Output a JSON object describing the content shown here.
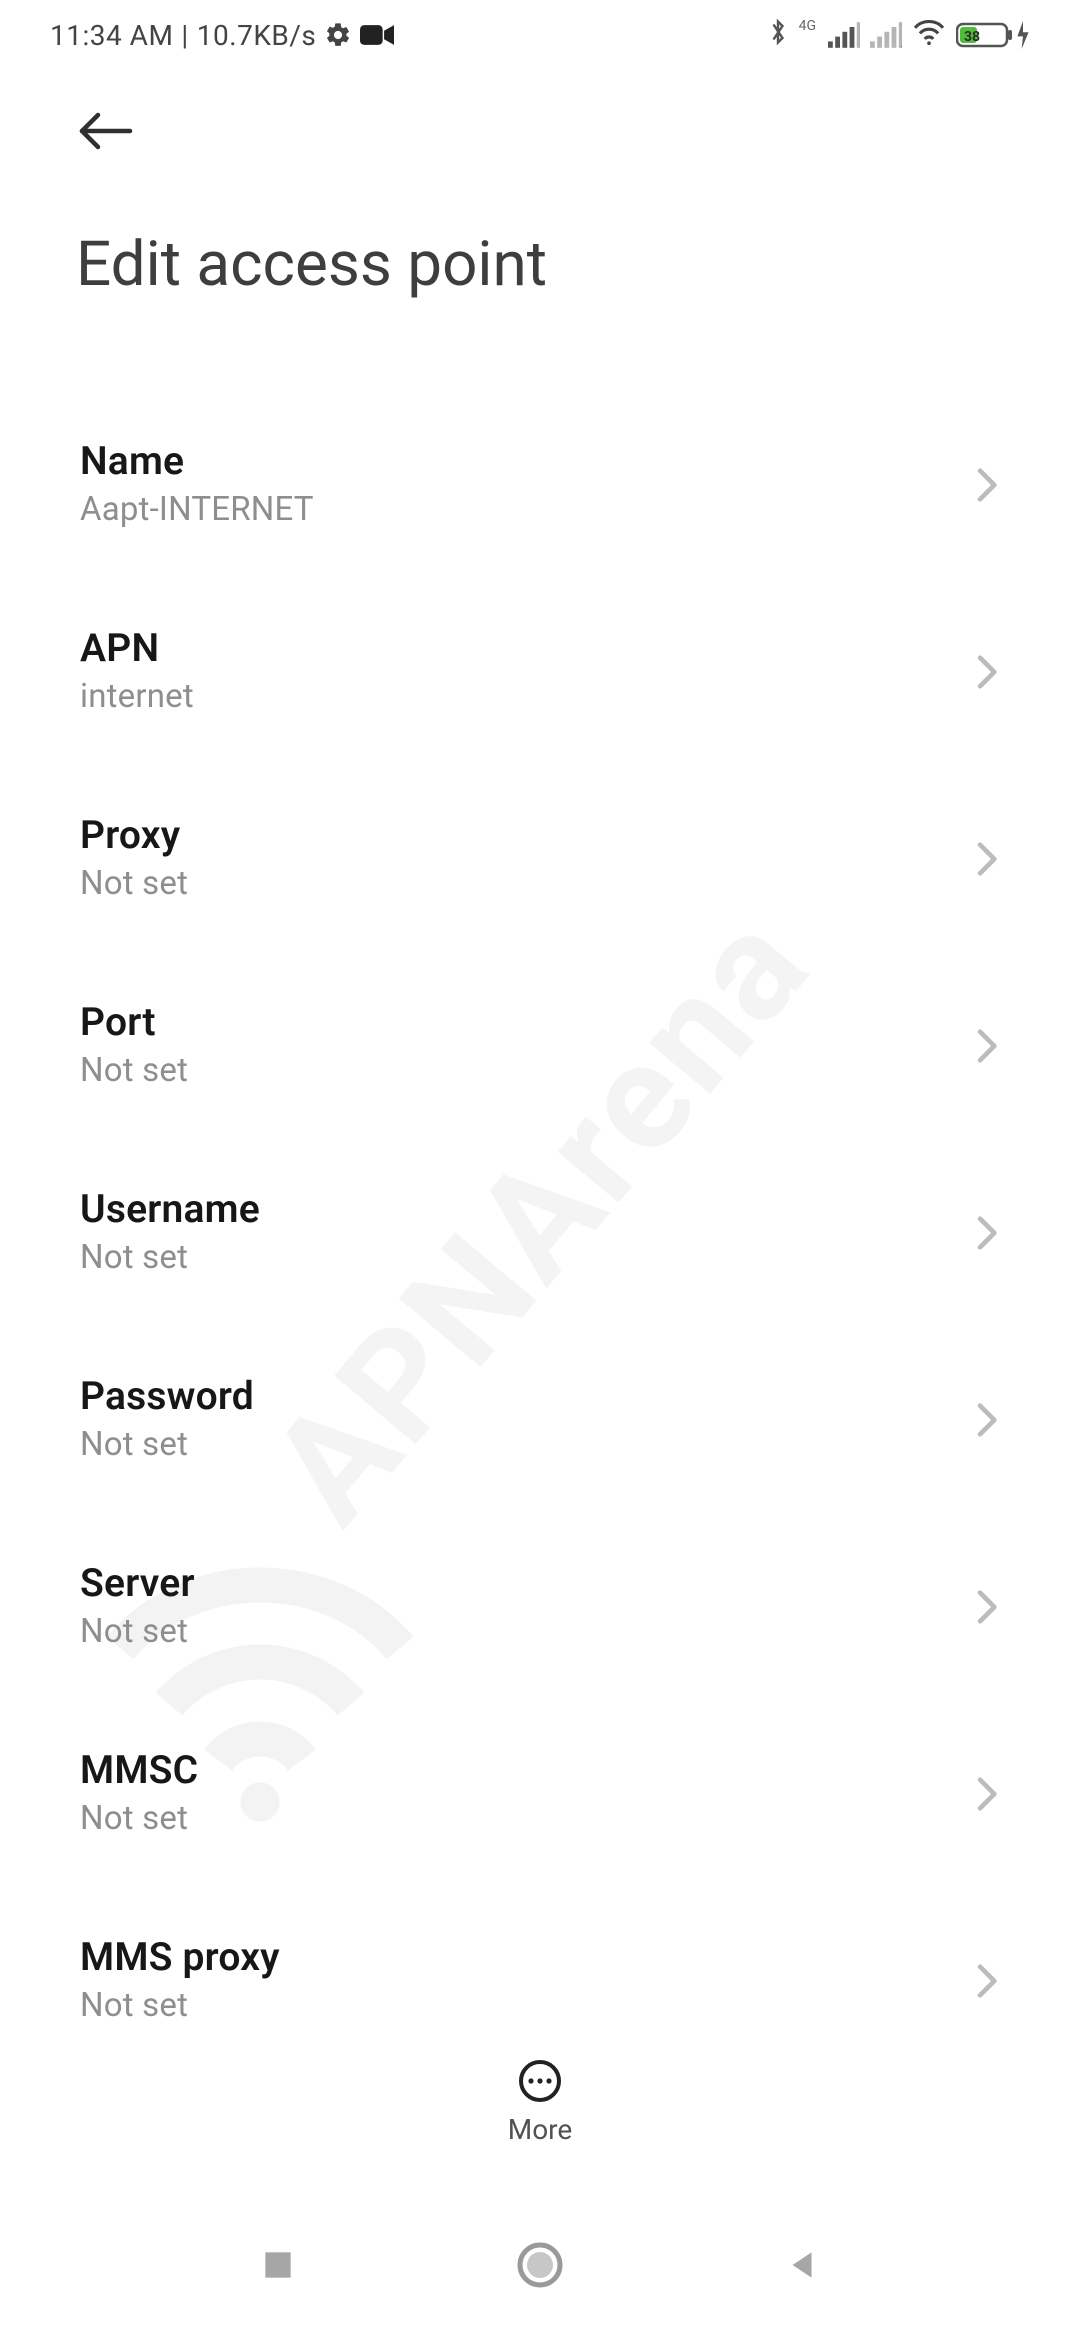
{
  "status": {
    "time": "11:34 AM",
    "speed": "10.7KB/s",
    "network_label": "4G",
    "battery_percent": "38"
  },
  "header": {
    "title": "Edit access point"
  },
  "rows": [
    {
      "title": "Name",
      "value": "Aapt-INTERNET"
    },
    {
      "title": "APN",
      "value": "internet"
    },
    {
      "title": "Proxy",
      "value": "Not set"
    },
    {
      "title": "Port",
      "value": "Not set"
    },
    {
      "title": "Username",
      "value": "Not set"
    },
    {
      "title": "Password",
      "value": "Not set"
    },
    {
      "title": "Server",
      "value": "Not set"
    },
    {
      "title": "MMSC",
      "value": "Not set"
    },
    {
      "title": "MMS proxy",
      "value": "Not set"
    }
  ],
  "bottom": {
    "more_label": "More"
  },
  "watermark": "APNArena"
}
